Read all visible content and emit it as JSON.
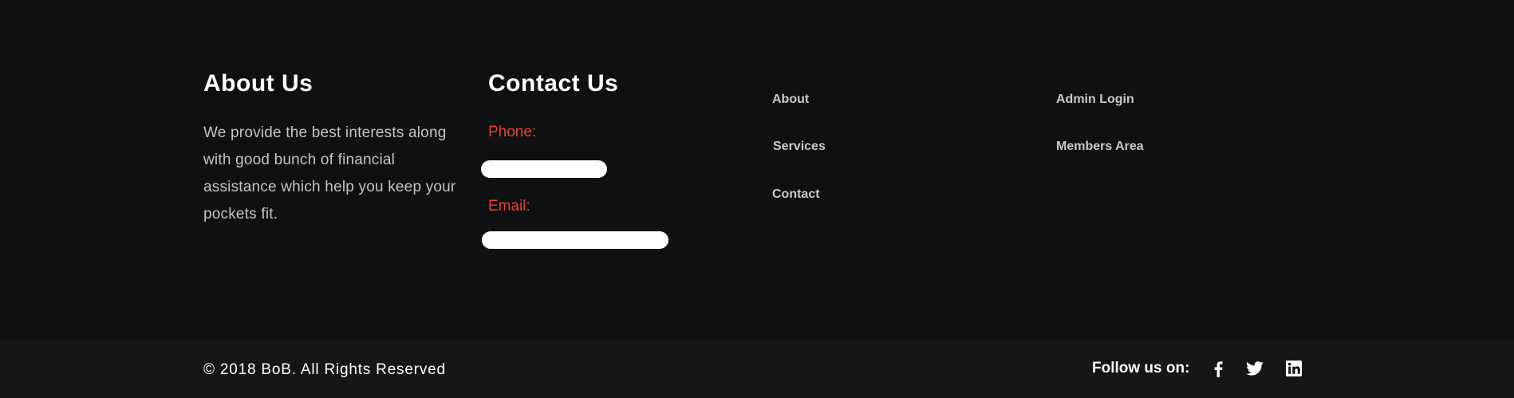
{
  "about": {
    "title": "About Us",
    "text": "We provide the best interests along with good bunch of financial assistance which help you keep your pockets fit."
  },
  "contact": {
    "title": "Contact Us",
    "phone_label": "Phone:",
    "email_label": "Email:"
  },
  "links_col1": [
    "About",
    "Services",
    "Contact"
  ],
  "links_col2": [
    "Admin Login",
    "Members Area"
  ],
  "bottom": {
    "copyright": "© 2018 BoB. All Rights Reserved",
    "follow_label": "Follow us on:",
    "social_icons": [
      "facebook-icon",
      "twitter-icon",
      "linkedin-icon"
    ]
  },
  "colors": {
    "background": "#0f1012",
    "bottom_bar": "#161616",
    "accent": "#e8432b"
  }
}
